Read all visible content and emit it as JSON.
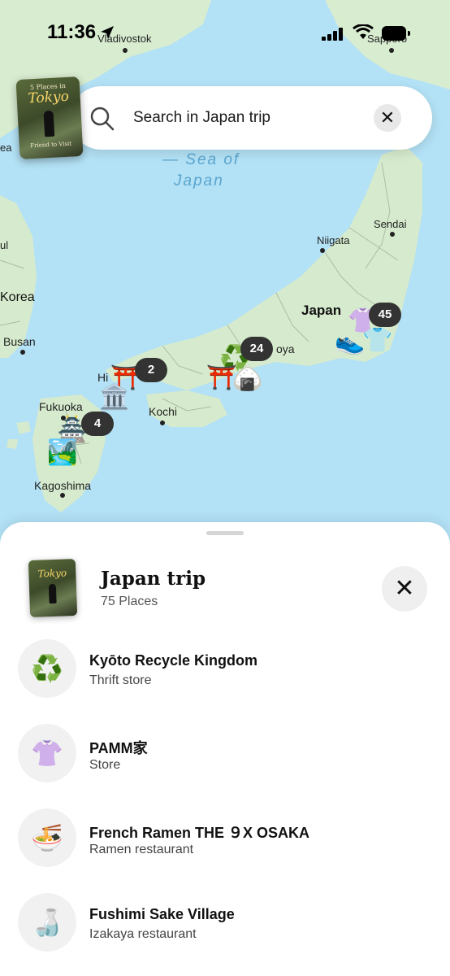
{
  "status_bar": {
    "time": "11:36"
  },
  "search": {
    "placeholder": "Search in Japan trip"
  },
  "cover": {
    "line1": "5 Places in",
    "line2": "Tokyo",
    "line3": "Friend to Visit"
  },
  "map": {
    "labels": {
      "vladivostok": "Vladivostok",
      "sapporo": "Sapporo",
      "sea": "Sea of Japan",
      "sea_line1": "— Sea of",
      "sea_line2": "Japan",
      "sendai": "Sendai",
      "niigata": "Niigata",
      "korea": "Korea",
      "japan": "Japan",
      "busan": "Busan",
      "nagoya": "oya",
      "hiroshima": "Hi",
      "fukuoka": "Fukuoka",
      "kochi": "Kochi",
      "kagoshima": "Kagoshima",
      "edge_ea": "ea",
      "edge_ul": "ul"
    },
    "clusters": [
      {
        "count": "45",
        "icons": [
          "👚",
          "👕",
          "👟"
        ]
      },
      {
        "count": "24",
        "icons": [
          "♻️",
          "⛩️",
          "🍙"
        ]
      },
      {
        "count": "2",
        "icons": [
          "⛩️",
          "🏛️"
        ]
      },
      {
        "count": "4",
        "icons": [
          "🏯",
          "🏞️"
        ]
      }
    ]
  },
  "sheet": {
    "title": "Japan trip",
    "subtitle": "75 Places",
    "items": [
      {
        "name": "Kyōto Recycle Kingdom",
        "type": "Thrift store",
        "icon": "♻️"
      },
      {
        "name": "PAMM家",
        "type": "Store",
        "icon": "👚"
      },
      {
        "name": "French Ramen THE ９X OSAKA",
        "type": "Ramen restaurant",
        "icon": "🍜"
      },
      {
        "name": "Fushimi Sake Village",
        "type": "Izakaya restaurant",
        "icon": "🍶"
      }
    ]
  }
}
